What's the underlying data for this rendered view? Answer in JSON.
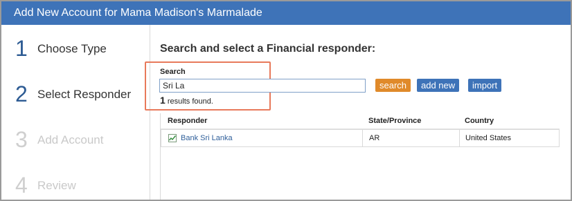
{
  "window": {
    "title": "Add New Account for Mama Madison's Marmalade"
  },
  "steps": [
    {
      "number": "1",
      "label": "Choose Type",
      "state": "active"
    },
    {
      "number": "2",
      "label": "Select Responder",
      "state": "active"
    },
    {
      "number": "3",
      "label": "Add Account",
      "state": "inactive"
    },
    {
      "number": "4",
      "label": "Review",
      "state": "inactive"
    }
  ],
  "main": {
    "heading": "Search and select a Financial responder:",
    "search": {
      "label": "Search",
      "value": "Sri La",
      "results_count": "1",
      "results_text": "results found."
    },
    "buttons": {
      "search_label": "search",
      "add_new_label": "add new",
      "import_label": "import"
    },
    "table": {
      "columns": [
        "Responder",
        "State/Province",
        "Country"
      ],
      "rows": [
        {
          "responder": "Bank Sri Lanka",
          "state": "AR",
          "country": "United States",
          "icon": "bank-icon"
        }
      ]
    }
  },
  "colors": {
    "title_bar": "#3e73b8",
    "search_button": "#e08a2a",
    "action_button": "#3e73b8",
    "highlight_box": "#e8795a"
  }
}
